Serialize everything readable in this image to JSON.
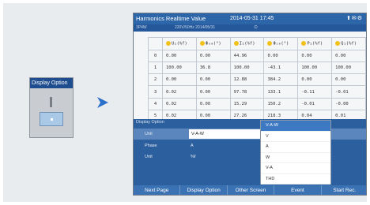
{
  "mini_window": {
    "title": "Display Option"
  },
  "header": {
    "title": "Harmonics Realtime Value",
    "datetime": "2014-05-31 17:45",
    "status_icons": "⬆✉⚙",
    "sub1": "3P4W",
    "sub2": "220V/50Hz  2014/05/31",
    "sub3": "⊙"
  },
  "table": {
    "columns": [
      "",
      "U₁(%f)",
      "Φᵤₘ(°)",
      "I₁(%f)",
      "Φᵢₘ(°)",
      "P₁(%f)",
      "Q₁(%f)"
    ],
    "rows": [
      [
        "0",
        "0.00",
        "0.00",
        "44.96",
        "0.00",
        "0.00",
        "0.00"
      ],
      [
        "1",
        "100.00",
        "36.8",
        "100.00",
        "-43.1",
        "100.00",
        "100.00"
      ],
      [
        "2",
        "0.00",
        "0.00",
        "12.88",
        "384.2",
        "0.00",
        "0.00"
      ],
      [
        "3",
        "0.02",
        "0.00",
        "97.78",
        "133.1",
        "-0.11",
        "-0.01"
      ],
      [
        "4",
        "0.02",
        "0.00",
        "15.29",
        "150.2",
        "-0.01",
        "-0.00"
      ],
      [
        "5",
        "0.02",
        "0.00",
        "27.26",
        "218.3",
        "0.04",
        "0.01"
      ]
    ]
  },
  "dialog": {
    "title": "Display Option",
    "rows": [
      {
        "label": "Unit",
        "value": "V-A-W"
      },
      {
        "label": "Phase",
        "value": "A"
      },
      {
        "label": "Unit",
        "value": "%f"
      }
    ]
  },
  "dropdown": {
    "options": [
      "V-A-W",
      "V",
      "A",
      "W",
      "V-A",
      "THD"
    ],
    "selected": "V-A-W"
  },
  "softkeys": [
    "Next Page",
    "Display Option",
    "Other Screen",
    "Event",
    "Start Rec."
  ],
  "colors": {
    "title_bar": "#2c66a9",
    "dialog": "#2b5f9e",
    "accent": "#3d78c2",
    "arrow": "#2a6fc9"
  }
}
